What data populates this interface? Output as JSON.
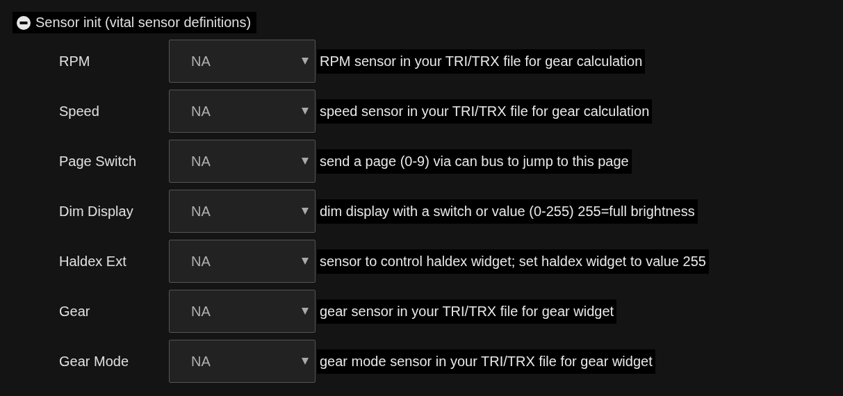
{
  "section": {
    "title": "Sensor init (vital sensor definitions)",
    "expanded": true
  },
  "rows": [
    {
      "label": "RPM",
      "value": "NA",
      "description": "RPM sensor in your TRI/TRX file for gear calculation"
    },
    {
      "label": "Speed",
      "value": "NA",
      "description": "speed sensor in your TRI/TRX file for gear calculation"
    },
    {
      "label": "Page Switch",
      "value": "NA",
      "description": "send a page (0-9) via can bus to jump to this page"
    },
    {
      "label": "Dim Display",
      "value": "NA",
      "description": "dim display with a switch or value (0-255) 255=full brightness"
    },
    {
      "label": "Haldex Ext",
      "value": "NA",
      "description": "sensor to control haldex widget; set haldex widget to value 255"
    },
    {
      "label": "Gear",
      "value": "NA",
      "description": "gear sensor in your TRI/TRX file for gear widget"
    },
    {
      "label": "Gear Mode",
      "value": "NA",
      "description": "gear mode sensor in your TRI/TRX file for gear widget"
    }
  ]
}
